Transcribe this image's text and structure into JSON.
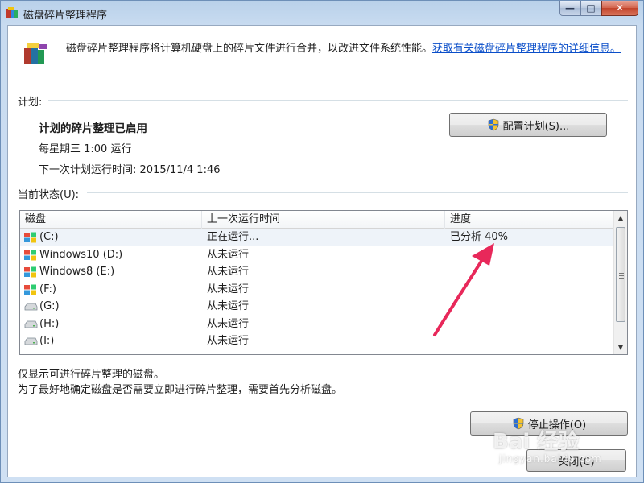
{
  "window": {
    "title": "磁盘碎片整理程序",
    "icon": "defrag-app-icon",
    "controls": {
      "minimize": "—",
      "maximize": "□",
      "close": "✕"
    }
  },
  "header": {
    "description": "磁盘碎片整理程序将计算机硬盘上的碎片文件进行合并，以改进文件系统性能。",
    "link": "获取有关磁盘碎片整理程序的详细信息。"
  },
  "schedule": {
    "section_label": "计划:",
    "status": "计划的碎片整理已启用",
    "run_time": "每星期三  1:00 运行",
    "next_run": "下一次计划运行时间: 2015/11/4 1:46",
    "configure_button": "配置计划(S)..."
  },
  "current_status": {
    "section_label": "当前状态(U):",
    "columns": [
      "磁盘",
      "上一次运行时间",
      "进度"
    ],
    "rows": [
      {
        "disk": "(C:)",
        "last_run": "正在运行...",
        "progress": "已分析 40%",
        "icon": "windows-drive-icon"
      },
      {
        "disk": "Windows10 (D:)",
        "last_run": "从未运行",
        "progress": "",
        "icon": "windows-drive-icon"
      },
      {
        "disk": "Windows8 (E:)",
        "last_run": "从未运行",
        "progress": "",
        "icon": "windows-drive-icon"
      },
      {
        "disk": "(F:)",
        "last_run": "从未运行",
        "progress": "",
        "icon": "windows-drive-icon"
      },
      {
        "disk": "(G:)",
        "last_run": "从未运行",
        "progress": "",
        "icon": "hard-drive-icon"
      },
      {
        "disk": "(H:)",
        "last_run": "从未运行",
        "progress": "",
        "icon": "hard-drive-icon"
      },
      {
        "disk": "(I:)",
        "last_run": "从未运行",
        "progress": "",
        "icon": "hard-drive-icon"
      }
    ]
  },
  "notes": {
    "line1": "仅显示可进行碎片整理的磁盘。",
    "line2": "为了最好地确定磁盘是否需要立即进行碎片整理，需要首先分析磁盘。"
  },
  "actions": {
    "stop_button": "停止操作(O)",
    "close_button": "关闭(C)"
  },
  "watermark": {
    "brand": "Bai 经验",
    "url": "jingyan.baidu.com"
  },
  "colors": {
    "link": "#0a4ec9",
    "annotation_arrow": "#e8285a"
  }
}
